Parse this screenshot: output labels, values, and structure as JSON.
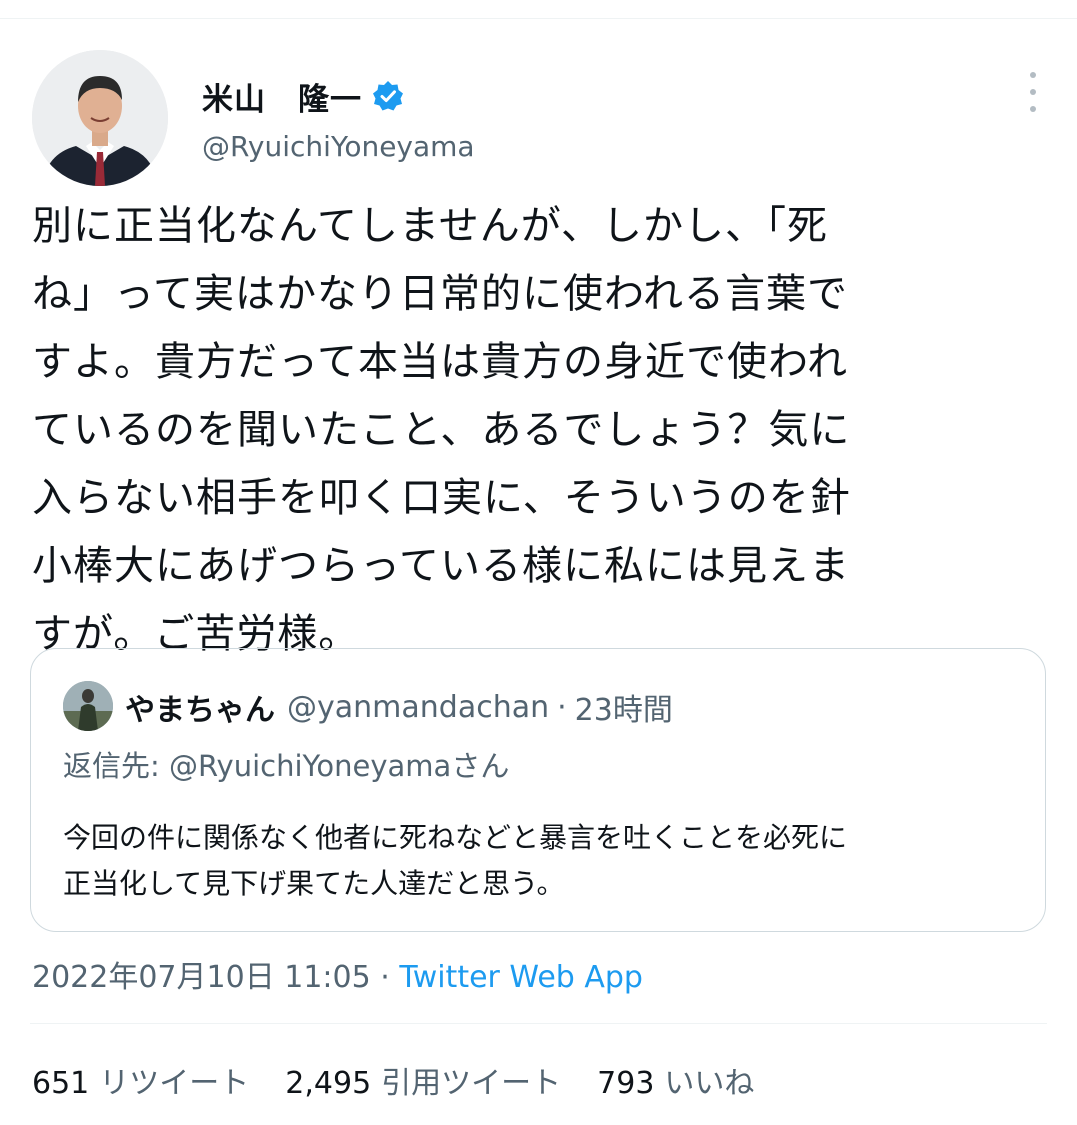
{
  "author": {
    "display_name": "米山　隆一",
    "handle": "@RyuichiYoneyama",
    "verified": true
  },
  "tweet": {
    "lines": [
      "別に正当化なんてしませんが、しかし、「死",
      "ね」って実はかなり日常的に使われる言葉で",
      "すよ。貴方だって本当は貴方の身近で使われ",
      "ているのを聞いたこと、あるでしょう？気に",
      "入らない相手を叩く口実に、そういうのを針",
      "小棒大にあげつらっている様に私には見えま",
      "すが。ご苦労様。"
    ]
  },
  "quote": {
    "display_name": "やまちゃん",
    "handle": "@yanmandachan",
    "separator": "·",
    "time": "23時間",
    "reply_to": "返信先: @RyuichiYoneyamaさん",
    "body_lines": [
      "今回の件に関係なく他者に死ねなどと暴言を吐くことを必死に",
      "正当化して見下げ果てた人達だと思う。"
    ]
  },
  "meta": {
    "timestamp": "2022年07月10日 11:05",
    "separator": "·",
    "source": "Twitter Web App"
  },
  "stats": {
    "retweets": {
      "count": "651",
      "label": "リツイート"
    },
    "quotes": {
      "count": "2,495",
      "label": "引用ツイート"
    },
    "likes": {
      "count": "793",
      "label": "いいね"
    }
  },
  "icons": {
    "verified": "verified-badge-icon",
    "more": "more-options-icon"
  },
  "colors": {
    "accent": "#1d9bf0",
    "secondary_text": "#536471",
    "primary_text": "#0f1419",
    "border": "#cfd9de"
  }
}
